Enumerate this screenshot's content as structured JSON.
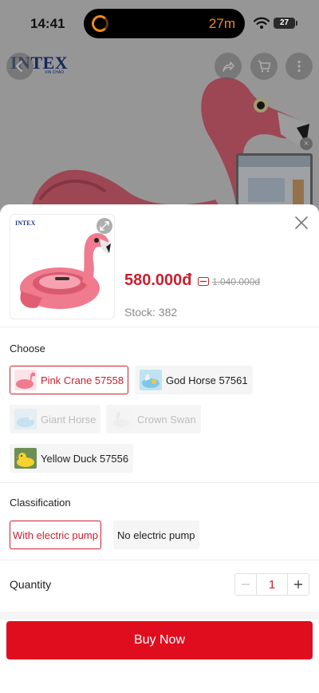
{
  "status": {
    "time": "14:41",
    "timer": "27m",
    "battery": "27"
  },
  "background": {
    "brand": "INTEX",
    "brand_sub": "XIN CHÀO"
  },
  "product": {
    "price": "580.000đ",
    "original_price": "1.040.000đ",
    "stock": "Stock: 382",
    "image_logo": "INTEX"
  },
  "choose": {
    "label": "Choose",
    "options": [
      {
        "label": "Pink Crane 57558",
        "state": "selected"
      },
      {
        "label": "God Horse 57561",
        "state": "normal"
      },
      {
        "label": "Giant Horse",
        "state": "disabled"
      },
      {
        "label": "Crown Swan",
        "state": "disabled"
      },
      {
        "label": "Yellow Duck 57556",
        "state": "normal"
      }
    ]
  },
  "classification": {
    "label": "Classification",
    "options": [
      {
        "label": "With electric pump",
        "state": "selected"
      },
      {
        "label": "No electric pump",
        "state": "normal"
      }
    ]
  },
  "quantity": {
    "label": "Quantity",
    "value": "1"
  },
  "buy_label": "Buy Now",
  "colors": {
    "accent": "#cc1f2e",
    "buy_button": "#e00d1e",
    "brand": "#1e3a8a"
  }
}
